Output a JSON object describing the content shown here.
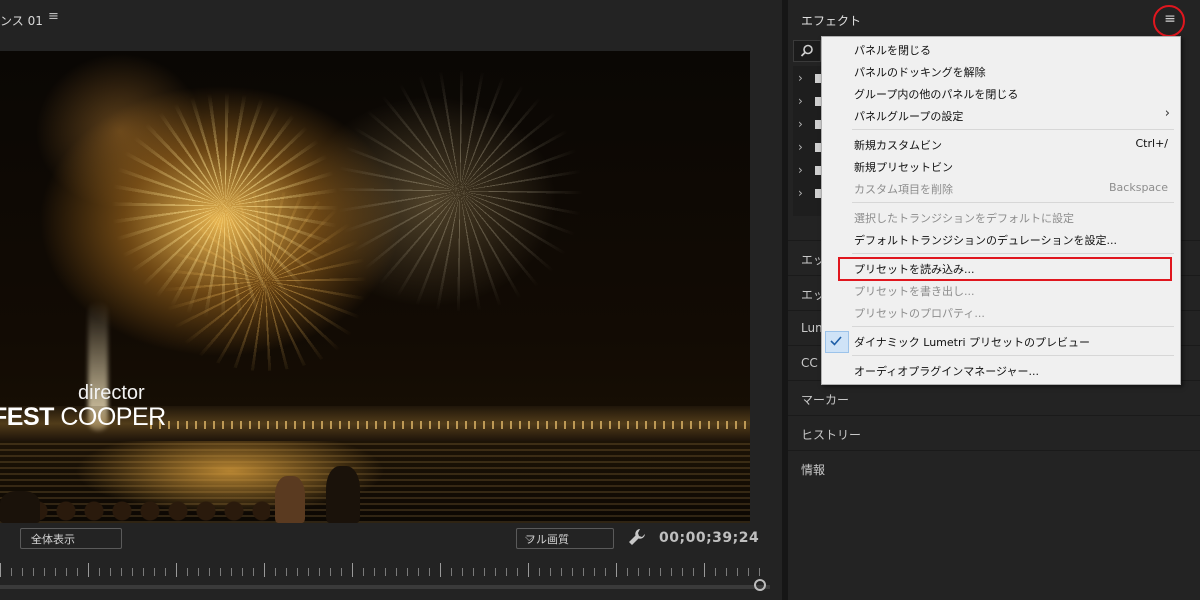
{
  "monitor": {
    "title": "ンス 01",
    "overlay_director": "director",
    "overlay_name_bold": "FEST",
    "overlay_name_light": "COOPER",
    "zoom_value": "全体表示",
    "quality_value": "フル画質",
    "timecode": "00;00;39;24"
  },
  "effects_panel": {
    "title": "エフェクト",
    "tree_items": 6,
    "sections": [
      "エッ",
      "エッ",
      "Lum",
      "CC",
      "マーカー",
      "ヒストリー",
      "情報"
    ]
  },
  "menu": {
    "items": [
      {
        "label": "パネルを閉じる",
        "enabled": true
      },
      {
        "label": "パネルのドッキングを解除",
        "enabled": true
      },
      {
        "label": "グループ内の他のパネルを閉じる",
        "enabled": true
      },
      {
        "label": "パネルグループの設定",
        "enabled": true,
        "submenu": true
      },
      {
        "label": "新規カスタムビン",
        "enabled": true,
        "shortcut": "Ctrl+/"
      },
      {
        "label": "新規プリセットビン",
        "enabled": true
      },
      {
        "label": "カスタム項目を削除",
        "enabled": false,
        "shortcut": "Backspace"
      },
      {
        "label": "選択したトランジションをデフォルトに設定",
        "enabled": false
      },
      {
        "label": "デフォルトトランジションのデュレーションを設定...",
        "enabled": true
      },
      {
        "label": "プリセットを読み込み...",
        "enabled": true,
        "highlighted": true
      },
      {
        "label": "プリセットを書き出し...",
        "enabled": false
      },
      {
        "label": "プリセットのプロパティ...",
        "enabled": false
      },
      {
        "label": "ダイナミック Lumetri プリセットのプレビュー",
        "enabled": true,
        "checked": true
      },
      {
        "label": "オーディオプラグインマネージャー...",
        "enabled": true
      }
    ]
  },
  "colors": {
    "panel_bg": "#232323",
    "menu_bg": "#f0f0f0",
    "annotation_red": "#e0161e",
    "check_bg": "#cfe3f7"
  },
  "icons": [
    "hamburger-icon",
    "search-icon",
    "wrench-icon",
    "chevron-down-icon",
    "chevron-right-icon",
    "checkmark-icon",
    "folder-icon"
  ]
}
